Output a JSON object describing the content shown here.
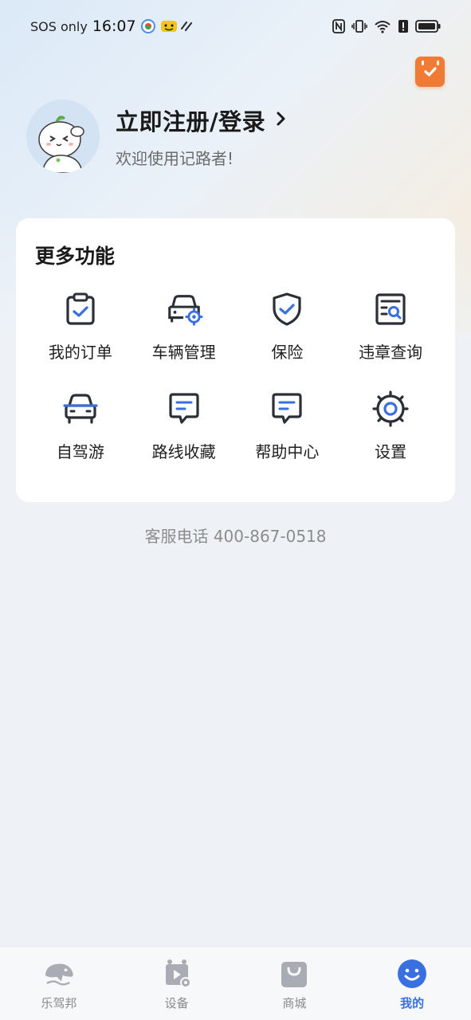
{
  "status_bar": {
    "carrier": "SOS only",
    "time": "16:07"
  },
  "header": {
    "login_title": "立即注册/登录",
    "welcome": "欢迎使用记路者!"
  },
  "features": {
    "title": "更多功能",
    "items": [
      {
        "label": "我的订单",
        "icon": "clipboard-check-icon"
      },
      {
        "label": "车辆管理",
        "icon": "car-gear-icon"
      },
      {
        "label": "保险",
        "icon": "shield-check-icon"
      },
      {
        "label": "违章查询",
        "icon": "document-search-icon"
      },
      {
        "label": "自驾游",
        "icon": "car-front-icon"
      },
      {
        "label": "路线收藏",
        "icon": "message-lines-icon"
      },
      {
        "label": "帮助中心",
        "icon": "help-message-icon"
      },
      {
        "label": "设置",
        "icon": "gear-icon"
      }
    ]
  },
  "hotline": "客服电话 400-867-0518",
  "bottom_nav": {
    "items": [
      {
        "label": "乐驾邦",
        "icon": "dolphin-icon",
        "active": false
      },
      {
        "label": "设备",
        "icon": "device-video-icon",
        "active": false
      },
      {
        "label": "商城",
        "icon": "shopping-bag-icon",
        "active": false
      },
      {
        "label": "我的",
        "icon": "smiley-icon",
        "active": true
      }
    ]
  },
  "colors": {
    "accent_blue": "#3a6fe0",
    "icon_dark": "#2b2f36",
    "calendar_orange": "#f07b34"
  }
}
